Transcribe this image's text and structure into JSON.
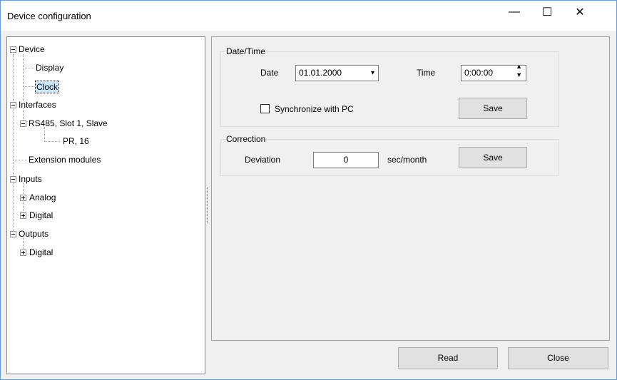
{
  "window": {
    "title": "Device configuration"
  },
  "titlebar_buttons": {
    "minimize": "—",
    "maximize": "☐",
    "close": "✕"
  },
  "tree": {
    "device": "Device",
    "display": "Display",
    "clock": "Clock",
    "interfaces": "Interfaces",
    "rs485": "RS485, Slot 1, Slave",
    "pr16": "PR, 16",
    "extension_modules": "Extension modules",
    "inputs": "Inputs",
    "analog": "Analog",
    "inputs_digital": "Digital",
    "outputs": "Outputs",
    "outputs_digital": "Digital",
    "selected": "Clock"
  },
  "datetime": {
    "legend": "Date/Time",
    "date_label": "Date",
    "date_value": "01.01.2000",
    "time_label": "Time",
    "time_value": "0:00:00",
    "sync_label": "Synchronize with PC",
    "sync_checked": false,
    "save_label": "Save"
  },
  "correction": {
    "legend": "Correction",
    "deviation_label": "Deviation",
    "deviation_value": "0",
    "unit": "sec/month",
    "save_label": "Save"
  },
  "footer": {
    "read_label": "Read",
    "close_label": "Close"
  }
}
